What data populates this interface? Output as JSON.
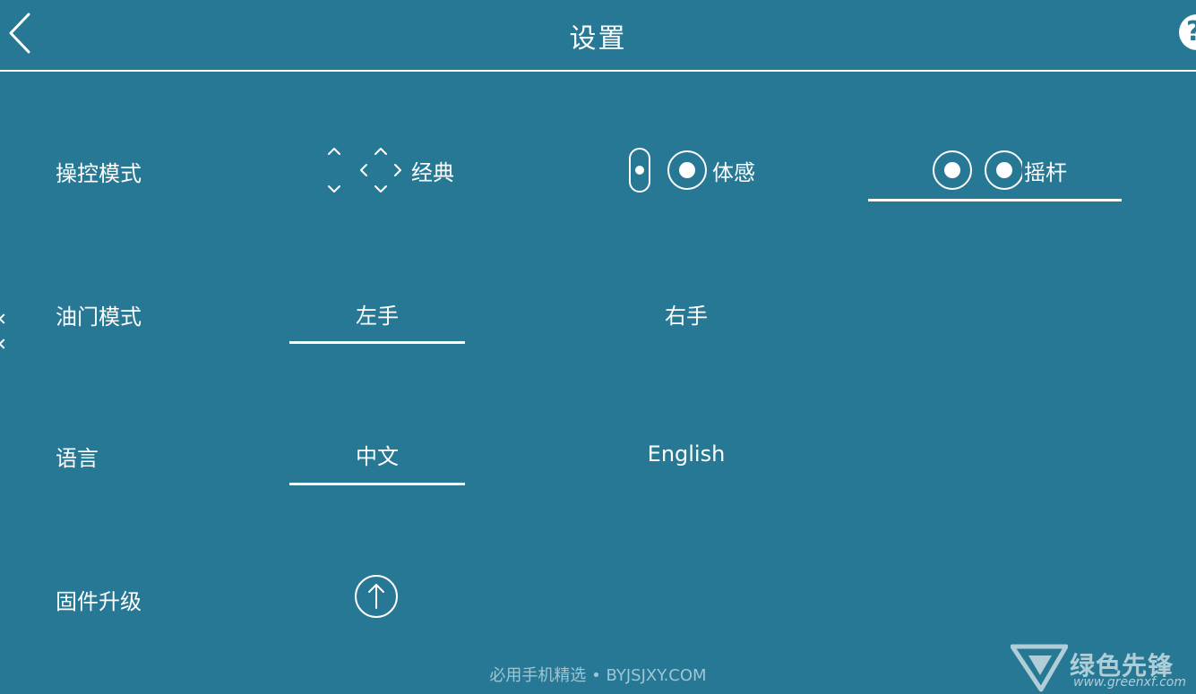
{
  "header": {
    "title": "设置",
    "back_icon": "chevron-left-icon",
    "help_icon": "question-icon",
    "help_glyph": "?"
  },
  "rows": {
    "control_mode": {
      "label": "操控模式",
      "options": [
        {
          "label": "经典",
          "icon": "dpad-arrows-icon",
          "selected": false
        },
        {
          "label": "体感",
          "icon": "motion-sense-icon",
          "selected": false
        },
        {
          "label": "摇杆",
          "icon": "dual-joystick-icon",
          "selected": true
        }
      ]
    },
    "throttle_mode": {
      "label": "油门模式",
      "options": [
        {
          "label": "左手",
          "selected": true
        },
        {
          "label": "右手",
          "selected": false
        }
      ]
    },
    "language": {
      "label": "语言",
      "options": [
        {
          "label": "中文",
          "selected": true
        },
        {
          "label": "English",
          "selected": false
        }
      ]
    },
    "firmware": {
      "label": "固件升级",
      "icon": "upload-arrow-icon"
    }
  },
  "footer": {
    "text": "必用手机精选 • BYJSJXY.COM"
  },
  "watermark": {
    "brand": "绿色先锋",
    "url": "www.greenxf.com"
  },
  "colors": {
    "background": "#267894",
    "foreground": "#ffffff"
  }
}
